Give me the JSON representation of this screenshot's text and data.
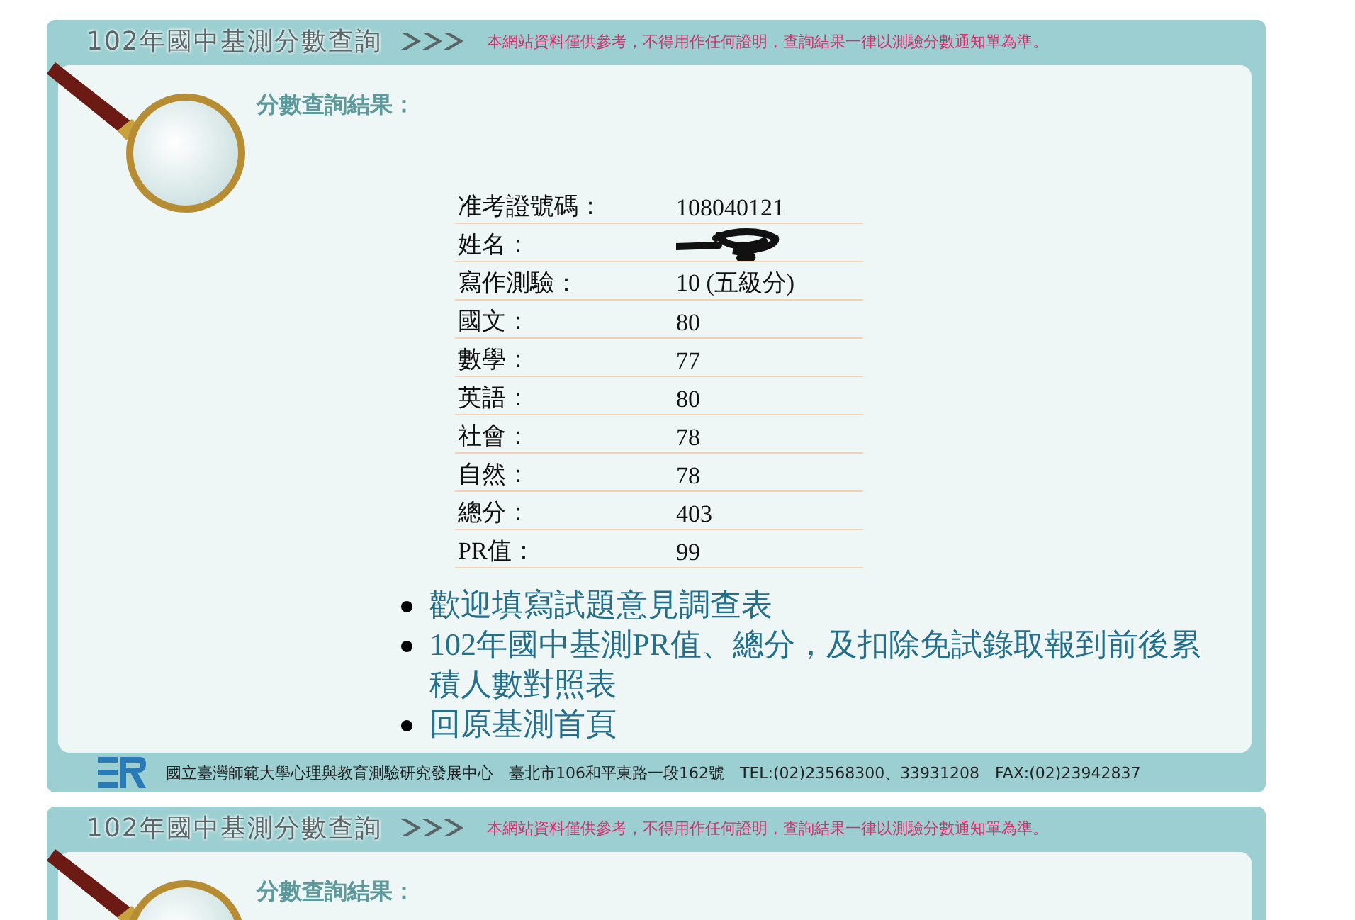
{
  "header": {
    "title": "102年國中基測分數查詢",
    "notice": "本網站資料僅供參考，不得用作任何證明，查詢結果一律以測驗分數通知單為準。"
  },
  "result_heading": "分數查詢結果：",
  "rows": [
    {
      "kind": "text",
      "label": "准考證號碼：",
      "value": "108040121"
    },
    {
      "kind": "redacted",
      "label": "姓名："
    },
    {
      "kind": "text",
      "label": "寫作測驗：",
      "value": "10 (五級分)"
    },
    {
      "kind": "text",
      "label": "國文：",
      "value": "80"
    },
    {
      "kind": "text",
      "label": "數學：",
      "value": "77"
    },
    {
      "kind": "text",
      "label": "英語：",
      "value": "80"
    },
    {
      "kind": "text",
      "label": "社會：",
      "value": "78"
    },
    {
      "kind": "text",
      "label": "自然：",
      "value": "78"
    },
    {
      "kind": "text",
      "label": "總分：",
      "value": "403"
    },
    {
      "kind": "text",
      "label": "PR值：",
      "value": "99"
    }
  ],
  "links": [
    "歡迎填寫試題意見調查表",
    "102年國中基測PR值、總分，及扣除免試錄取報到前後累積人數對照表",
    "回原基測首頁"
  ],
  "footer": {
    "text": "國立臺灣師範大學心理與教育測驗研究發展中心　臺北市106和平東路一段162號　TEL:(02)23568300、33931208　FAX:(02)23942837"
  },
  "repeat_block": {
    "title": "102年國中基測分數查詢",
    "notice": "本網站資料僅供參考，不得用作任何證明，查詢結果一律以測驗分數通知單為準。",
    "result_heading": "分數查詢結果："
  }
}
